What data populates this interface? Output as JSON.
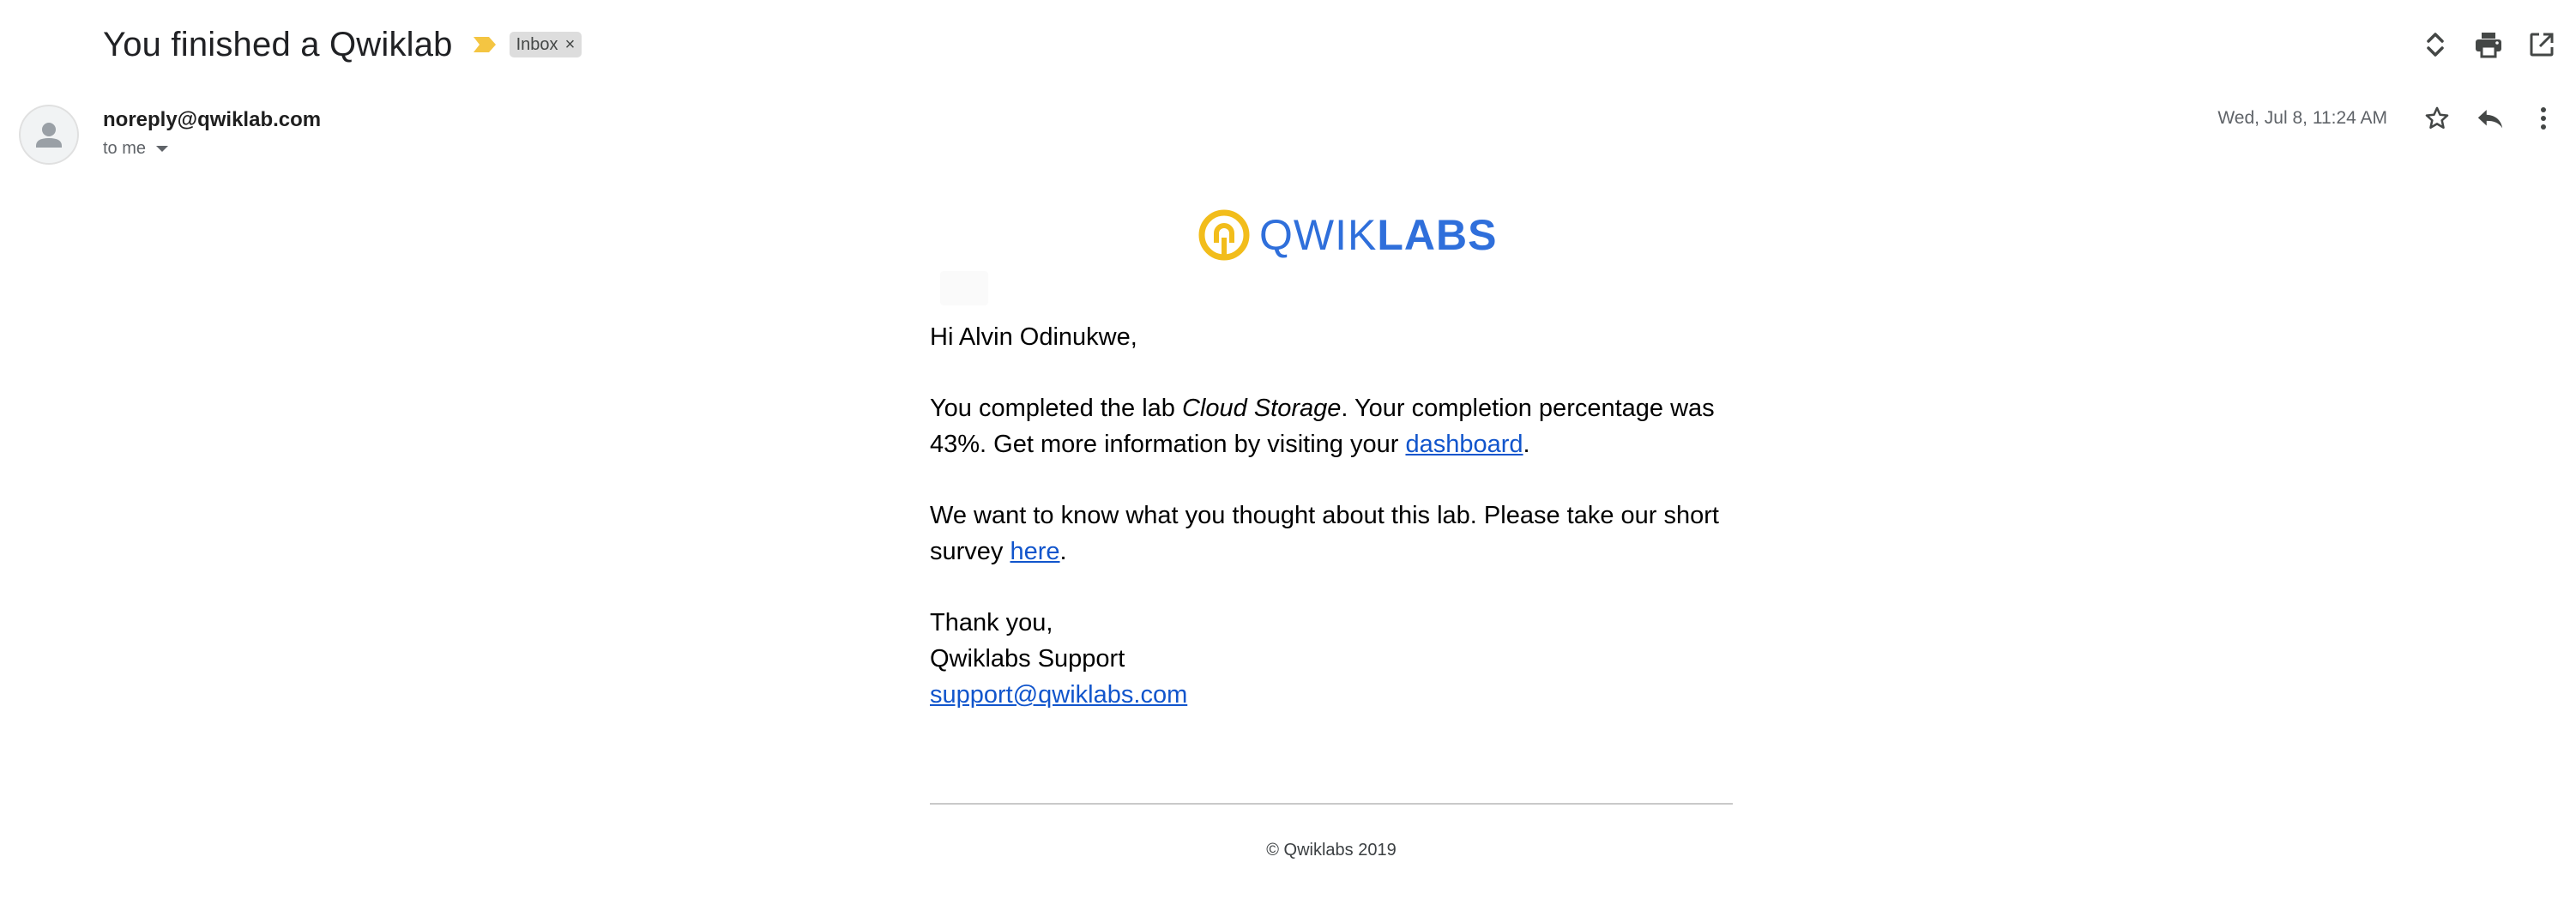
{
  "subject": "You finished a Qwiklab",
  "label_chip": {
    "text": "Inbox",
    "remove_glyph": "×"
  },
  "importance_marker": {
    "icon": "importance-marker-icon",
    "color": "#f4c542"
  },
  "top_actions": [
    {
      "name": "expand-collapse-icon",
      "label": "Expand all"
    },
    {
      "name": "print-icon",
      "label": "Print all"
    },
    {
      "name": "open-new-window-icon",
      "label": "In new window"
    }
  ],
  "message": {
    "sender": "noreply@qwiklab.com",
    "recipients": "to me",
    "date": "Wed, Jul 8, 11:24 AM",
    "actions": [
      {
        "name": "star-icon"
      },
      {
        "name": "reply-icon"
      },
      {
        "name": "more-vert-icon"
      }
    ]
  },
  "email": {
    "logo": {
      "text_light": "QWIK",
      "text_bold": "LABS",
      "mark_color": "#f2bd1b",
      "text_color": "#2f6fdb"
    },
    "greeting": "Hi Alvin Odinukwe,",
    "para1": {
      "before": "You completed the lab ",
      "lab_name": "Cloud Storage",
      "middle": ". Your completion percentage was 43%. Get more information by visiting your ",
      "link": "dashboard",
      "after": "."
    },
    "para2": {
      "before": "We want to know what you thought about this lab. Please take our short survey ",
      "link": "here",
      "after": "."
    },
    "signoff": {
      "line1": "Thank you,",
      "line2": "Qwiklabs Support",
      "email_link": "support@qwiklabs.com"
    },
    "footer": "© Qwiklabs 2019"
  },
  "colors": {
    "link": "#1155cc",
    "text": "#000000",
    "muted": "#5f6368"
  }
}
